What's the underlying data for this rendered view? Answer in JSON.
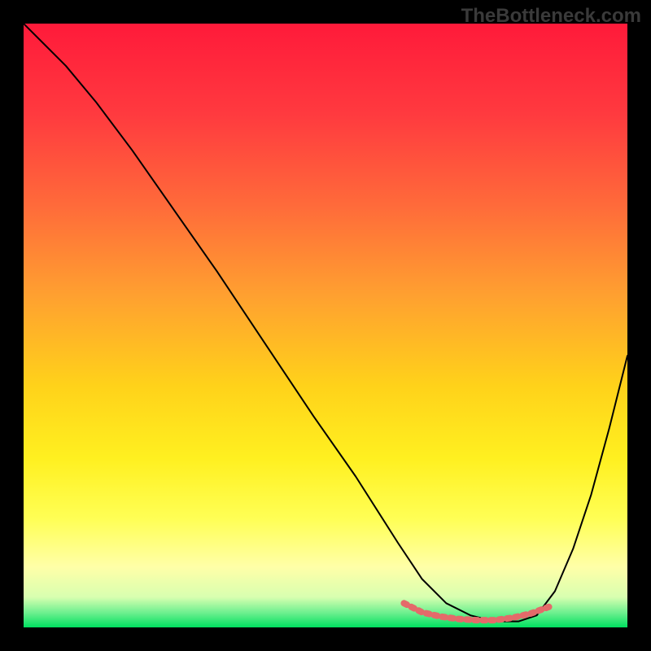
{
  "watermark": "TheBottleneck.com",
  "chart_data": {
    "type": "line",
    "title": "",
    "xlabel": "",
    "ylabel": "",
    "xlim": [
      0,
      100
    ],
    "ylim": [
      0,
      100
    ],
    "background_gradient": {
      "type": "vertical",
      "stops": [
        {
          "offset": 0.0,
          "color": "#ff1a3a"
        },
        {
          "offset": 0.15,
          "color": "#ff3a3f"
        },
        {
          "offset": 0.3,
          "color": "#ff6a3a"
        },
        {
          "offset": 0.45,
          "color": "#ffa030"
        },
        {
          "offset": 0.6,
          "color": "#ffd21a"
        },
        {
          "offset": 0.72,
          "color": "#fff020"
        },
        {
          "offset": 0.82,
          "color": "#ffff55"
        },
        {
          "offset": 0.9,
          "color": "#ffffa8"
        },
        {
          "offset": 0.95,
          "color": "#d8ffb0"
        },
        {
          "offset": 0.975,
          "color": "#70f090"
        },
        {
          "offset": 1.0,
          "color": "#00e060"
        }
      ]
    },
    "series": [
      {
        "name": "bottleneck-curve",
        "color": "#000000",
        "width": 2,
        "x": [
          0,
          3,
          7,
          12,
          18,
          25,
          32,
          40,
          48,
          55,
          62,
          66,
          70,
          74,
          78,
          82,
          85,
          88,
          91,
          94,
          97,
          100
        ],
        "y": [
          100,
          97,
          93,
          87,
          79,
          69,
          59,
          47,
          35,
          25,
          14,
          8,
          4,
          2,
          1,
          1,
          2,
          6,
          13,
          22,
          33,
          45
        ]
      },
      {
        "name": "optimal-band",
        "color": "#e46a6a",
        "width": 8,
        "dash": "4 6",
        "x": [
          63,
          66,
          69,
          72,
          75,
          78,
          81,
          84,
          87
        ],
        "y": [
          4,
          2.5,
          1.8,
          1.4,
          1.2,
          1.2,
          1.6,
          2.3,
          3.4
        ]
      }
    ]
  }
}
